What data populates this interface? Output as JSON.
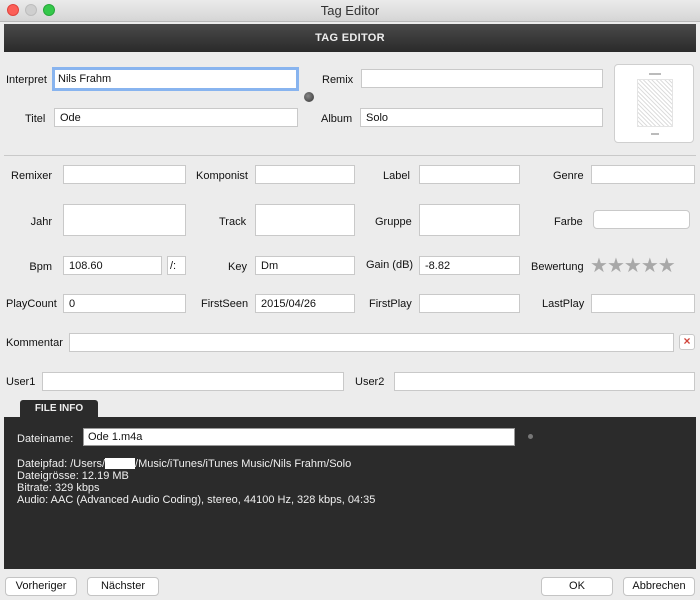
{
  "window": {
    "title": "Tag Editor"
  },
  "header": {
    "title": "TAG EDITOR"
  },
  "fields": {
    "interpret": {
      "label": "Interpret",
      "value": "Nils Frahm"
    },
    "remix": {
      "label": "Remix",
      "value": ""
    },
    "titel": {
      "label": "Titel",
      "value": "Ode"
    },
    "album": {
      "label": "Album",
      "value": "Solo"
    },
    "remixer": {
      "label": "Remixer",
      "value": ""
    },
    "komponist": {
      "label": "Komponist",
      "value": ""
    },
    "label": {
      "label": "Label",
      "value": ""
    },
    "genre": {
      "label": "Genre",
      "value": ""
    },
    "jahr": {
      "label": "Jahr",
      "value": ""
    },
    "track": {
      "label": "Track",
      "value": ""
    },
    "gruppe": {
      "label": "Gruppe",
      "value": ""
    },
    "farbe": {
      "label": "Farbe",
      "value": ""
    },
    "bpm": {
      "label": "Bpm",
      "value": "108.60",
      "button": "/:"
    },
    "key": {
      "label": "Key",
      "value": "Dm"
    },
    "gain": {
      "label": "Gain (dB)",
      "value": "-8.82"
    },
    "bewertung": {
      "label": "Bewertung",
      "stars": 0,
      "max": 5
    },
    "playcount": {
      "label": "PlayCount",
      "value": "0"
    },
    "firstseen": {
      "label": "FirstSeen",
      "value": "2015/04/26"
    },
    "firstplay": {
      "label": "FirstPlay",
      "value": ""
    },
    "lastplay": {
      "label": "LastPlay",
      "value": ""
    },
    "kommentar": {
      "label": "Kommentar",
      "value": ""
    },
    "user1": {
      "label": "User1",
      "value": ""
    },
    "user2": {
      "label": "User2",
      "value": ""
    }
  },
  "file_info": {
    "tab_label": "FILE INFO",
    "dateiname_label": "Dateiname:",
    "dateiname_value": "Ode 1.m4a",
    "dateipfad_prefix": "Dateipfad: /Users/",
    "dateipfad_suffix": "/Music/iTunes/iTunes Music/Nils Frahm/Solo",
    "dateigroesse": "Dateigrösse: 12.19 MB",
    "bitrate": "Bitrate: 329 kbps",
    "audio": "Audio: AAC (Advanced Audio Coding), stereo, 44100 Hz, 328 kbps, 04:35"
  },
  "buttons": {
    "prev": "Vorheriger",
    "next": "Nächster",
    "ok": "OK",
    "cancel": "Abbrechen",
    "clear": "×"
  },
  "colors": {
    "header_bg": "#2a2a2a",
    "focus_ring": "#88b4ef",
    "clear_x": "#d0433a"
  }
}
